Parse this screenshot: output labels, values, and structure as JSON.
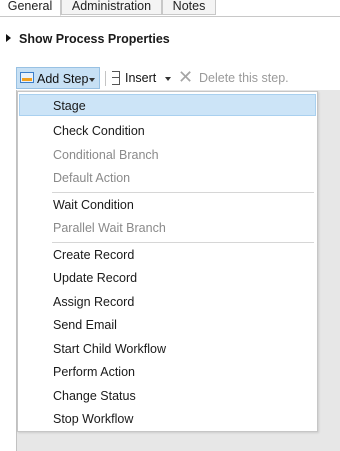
{
  "tabs": [
    {
      "label": "General"
    },
    {
      "label": "Administration"
    },
    {
      "label": "Notes"
    }
  ],
  "section": {
    "title": "Show Process Properties"
  },
  "toolbar": {
    "add_step": "Add Step",
    "insert": "Insert",
    "delete": "Delete this step."
  },
  "menu": {
    "items": [
      {
        "label": "Stage",
        "enabled": true
      },
      {
        "label": "Check Condition",
        "enabled": true
      },
      {
        "label": "Conditional Branch",
        "enabled": false
      },
      {
        "label": "Default Action",
        "enabled": false
      },
      {
        "label": "Wait Condition",
        "enabled": true
      },
      {
        "label": "Parallel Wait Branch",
        "enabled": false
      },
      {
        "label": "Create Record",
        "enabled": true
      },
      {
        "label": "Update Record",
        "enabled": true
      },
      {
        "label": "Assign Record",
        "enabled": true
      },
      {
        "label": "Send Email",
        "enabled": true
      },
      {
        "label": "Start Child Workflow",
        "enabled": true
      },
      {
        "label": "Perform Action",
        "enabled": true
      },
      {
        "label": "Change Status",
        "enabled": true
      },
      {
        "label": "Stop Workflow",
        "enabled": true
      }
    ]
  }
}
